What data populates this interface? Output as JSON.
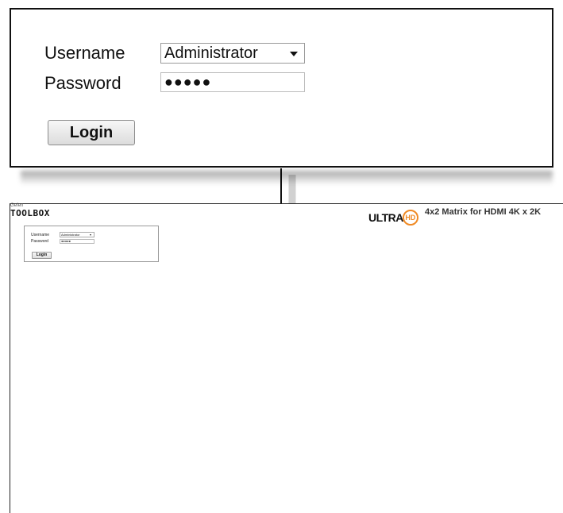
{
  "zoom_callout": {
    "username_label": "Username",
    "username_value": "Administrator",
    "password_label": "Password",
    "password_value": "●●●●●",
    "login_label": "Login"
  },
  "page": {
    "brand_small": "Gefen",
    "brand_logo": "TOOLBOX",
    "ultra_text": "ULTRA",
    "hd_text": "HD",
    "product_title": "4x2 Matrix for HDMI 4K x 2K",
    "login": {
      "username_label": "Username",
      "username_value": "Administrator",
      "password_label": "Password",
      "password_value": "●●●●●",
      "login_label": "Login"
    }
  },
  "colors": {
    "hd_accent": "#f08a24",
    "frame": "#222222"
  }
}
